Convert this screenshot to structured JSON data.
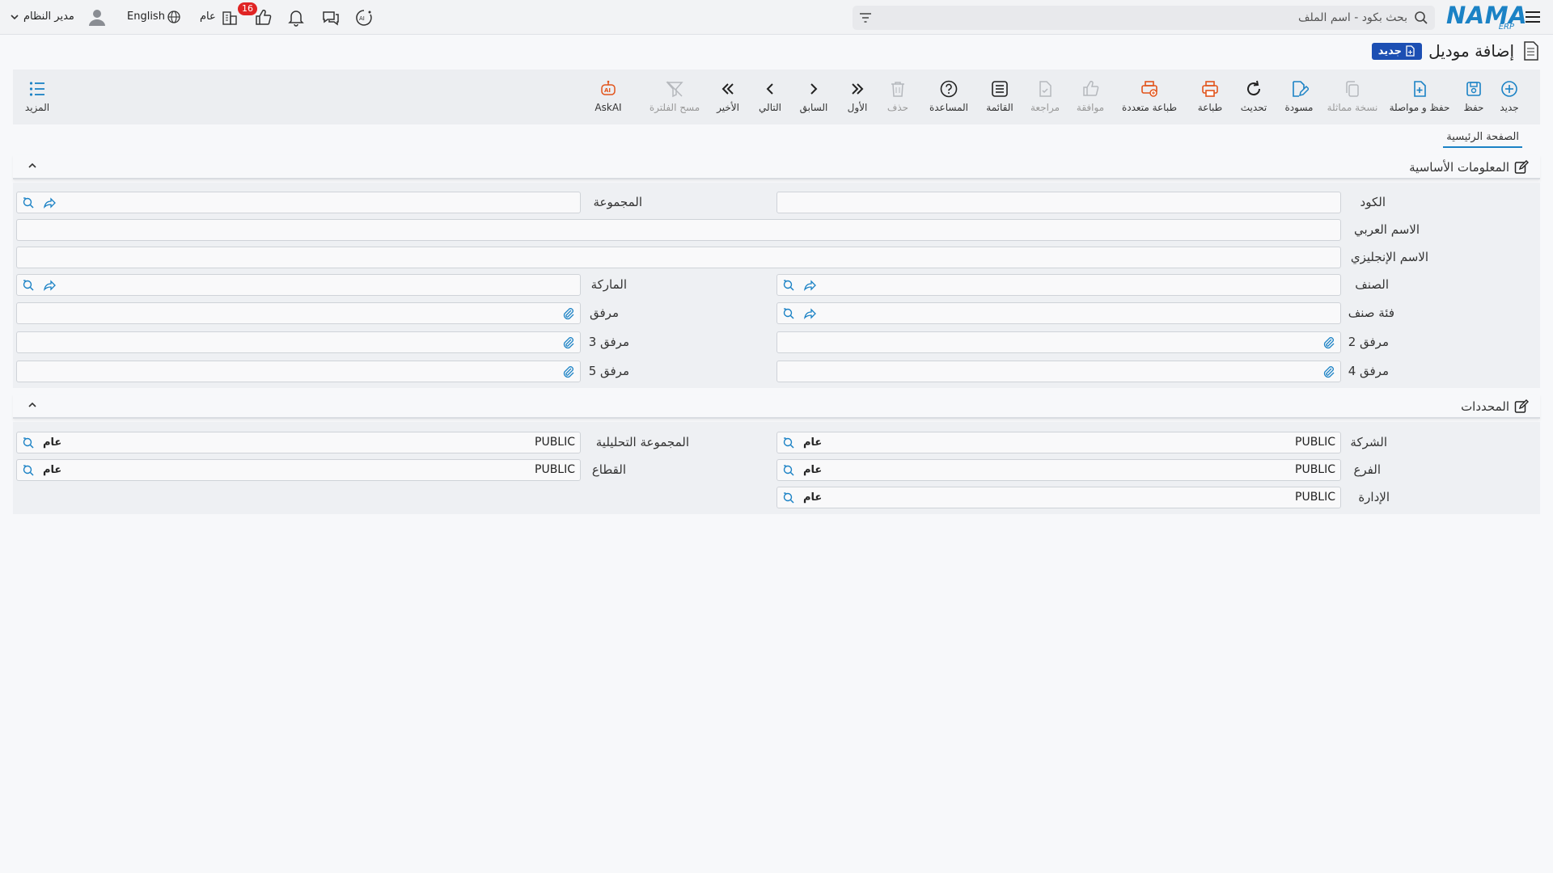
{
  "header": {
    "logo_text": "NAMA",
    "logo_sub": "ERP",
    "search_placeholder": "بحث بكود - اسم الملف",
    "notification_count": "16",
    "company_label": "عام",
    "language_label": "English",
    "user_name": "مدير النظام"
  },
  "page": {
    "title": "إضافة موديل",
    "mode_badge": "جديد"
  },
  "toolbar": {
    "new": "جديد",
    "save": "حفظ",
    "save_continue": "حفظ و مواصلة",
    "duplicate": "نسخة مماثلة",
    "draft": "مسودة",
    "refresh": "تحديث",
    "print": "طباعة",
    "multi_print": "طباعة متعددة",
    "approve": "موافقة",
    "review": "مراجعة",
    "list": "القائمة",
    "help": "المساعدة",
    "delete": "حذف",
    "first": "الأول",
    "previous": "السابق",
    "next": "التالي",
    "last": "الأخير",
    "clear_filter": "مسح الفلترة",
    "ask_ai": "AskAI",
    "more": "المزيد"
  },
  "tabs": {
    "main": "الصفحة الرئيسية"
  },
  "basic_info": {
    "section_title": "المعلومات الأساسية",
    "code_label": "الكود",
    "group_label": "المجموعة",
    "arabic_name_label": "الاسم العربي",
    "english_name_label": "الاسم الإنجليزي",
    "item_label": "الصنف",
    "brand_label": "الماركة",
    "item_category_label": "فئة صنف",
    "attachment_label": "مرفق",
    "attachment2_label": "مرفق 2",
    "attachment3_label": "مرفق 3",
    "attachment4_label": "مرفق 4",
    "attachment5_label": "مرفق 5",
    "code_value": "",
    "group_value": "",
    "arabic_name_value": "",
    "english_name_value": "",
    "item_value": "",
    "brand_value": "",
    "item_category_value": ""
  },
  "dimensions": {
    "section_title": "المحددات",
    "company_label": "الشركة",
    "company_code": "PUBLIC",
    "company_name": "عام",
    "analytic_group_label": "المجموعة التحليلية",
    "analytic_group_code": "PUBLIC",
    "analytic_group_name": "عام",
    "branch_label": "الفرع",
    "branch_code": "PUBLIC",
    "branch_name": "عام",
    "sector_label": "القطاع",
    "sector_code": "PUBLIC",
    "sector_name": "عام",
    "department_label": "الإدارة",
    "department_code": "PUBLIC",
    "department_name": "عام"
  },
  "colors": {
    "brand_blue": "#1b82c5",
    "badge_red": "#e02424",
    "new_badge_bg": "#1c4fb3",
    "print_orange": "#e2541b"
  }
}
